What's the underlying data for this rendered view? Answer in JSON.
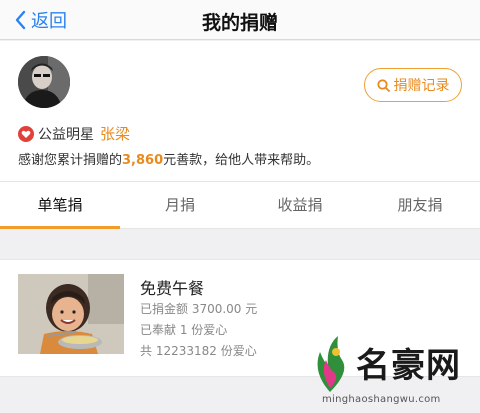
{
  "nav": {
    "back_label": "返回",
    "title": "我的捐赠"
  },
  "profile": {
    "record_label": "捐赠记录",
    "star_title": "公益明星",
    "star_name": "张梁",
    "thanks_prefix": "感谢您累计捐赠的",
    "thanks_amount": "3,860",
    "thanks_suffix": "元善款，给他人带来帮助。"
  },
  "tabs": [
    {
      "label": "单笔捐",
      "active": true
    },
    {
      "label": "月捐",
      "active": false
    },
    {
      "label": "收益捐",
      "active": false
    },
    {
      "label": "朋友捐",
      "active": false
    }
  ],
  "project": {
    "title": "免费午餐",
    "donated": "已捐金额 3700.00 元",
    "love": "已奉献 1 份爱心",
    "total": "共 12233182 份爱心"
  },
  "watermark": {
    "brand": "名豪网",
    "url": "minghaoshangwu.com"
  },
  "colors": {
    "accent": "#f29b2a",
    "link": "#2b82f0"
  }
}
